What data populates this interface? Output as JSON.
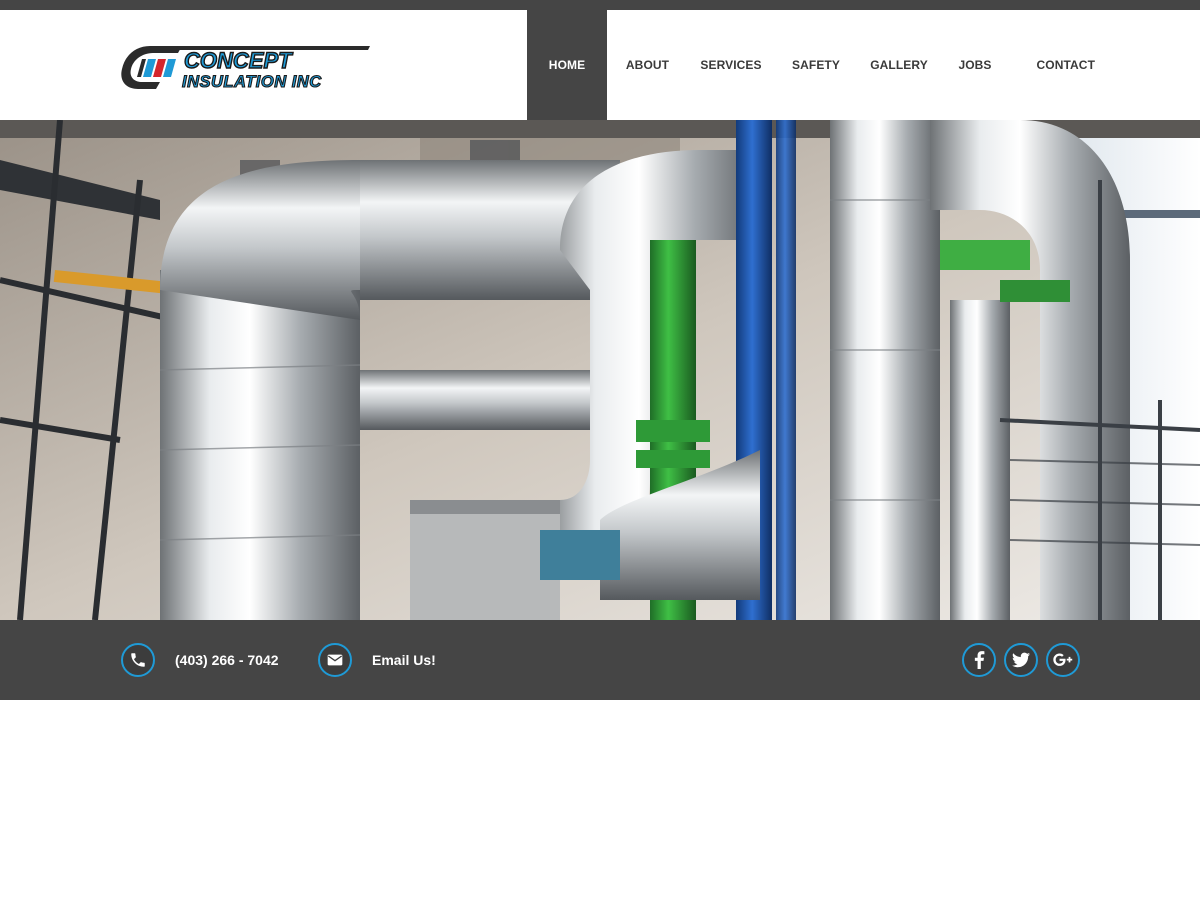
{
  "brand": {
    "logo_line1": "CONCEPT",
    "logo_line2": "INSULATION INC",
    "accent_color": "#1f9ad6",
    "dark_color": "#454545"
  },
  "nav": {
    "items": [
      {
        "label": "HOME",
        "active": true
      },
      {
        "label": "ABOUT",
        "active": false
      },
      {
        "label": "SERVICES",
        "active": false
      },
      {
        "label": "SAFETY",
        "active": false
      },
      {
        "label": "GALLERY",
        "active": false
      },
      {
        "label": "JOBS",
        "active": false
      },
      {
        "label": "CONTACT",
        "active": false
      }
    ]
  },
  "hero": {
    "image": "industrial-insulated-pipes-photo"
  },
  "contact": {
    "phone_icon": "phone-icon",
    "phone": "(403) 266 - 7042",
    "email_icon": "envelope-icon",
    "email_label": "Email Us!"
  },
  "social": [
    {
      "name": "facebook-icon"
    },
    {
      "name": "twitter-icon"
    },
    {
      "name": "google-plus-icon"
    }
  ]
}
